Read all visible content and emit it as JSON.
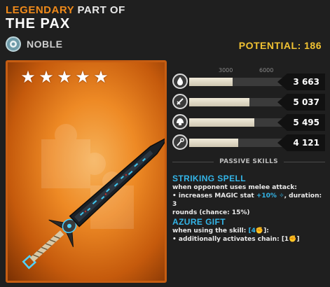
{
  "header": {
    "rarity": "LEGENDARY",
    "part_of": "PART OF",
    "name": "THE PAX",
    "class_label": "NOBLE",
    "class_icon": "lion-head-icon",
    "potential": "POTENTIAL: 186"
  },
  "card": {
    "stars": [
      "★",
      "★",
      "★",
      "★",
      "★"
    ],
    "item_icon": "sword-icon"
  },
  "stats": {
    "scale_labels": [
      "3000",
      "6000"
    ],
    "rows": [
      {
        "icon": "flame-drop-icon",
        "value_text": "3 663",
        "value": 3663
      },
      {
        "icon": "sword-swing-icon",
        "value_text": "5 037",
        "value": 5037
      },
      {
        "icon": "helmet-icon",
        "value_text": "5 495",
        "value": 5495
      },
      {
        "icon": "magic-staff-icon",
        "value_text": "4 121",
        "value": 4121
      }
    ],
    "max": 8000
  },
  "passive": {
    "header": "PASSIVE SKILLS",
    "skills": [
      {
        "name": "STRIKING SPELL",
        "line1": "when opponent uses melee attack:",
        "line2_a": "• increases MAGIC stat ",
        "line2_hl": "+10% ",
        "line2_b": ", duration: 3",
        "line3": "rounds (chance: 15%)"
      },
      {
        "name": "AZURE GIFT",
        "line1_a": "when using the skill: ",
        "line1_hl": "[4",
        "line1_b": "]:",
        "line2_a": "• additionally activates chain: [1",
        "line2_b": "]"
      }
    ]
  },
  "colors": {
    "legendary": "#f08a1a",
    "potential": "#f1c232",
    "skill_blue": "#33b5e8",
    "card_border": "#c65d12"
  }
}
